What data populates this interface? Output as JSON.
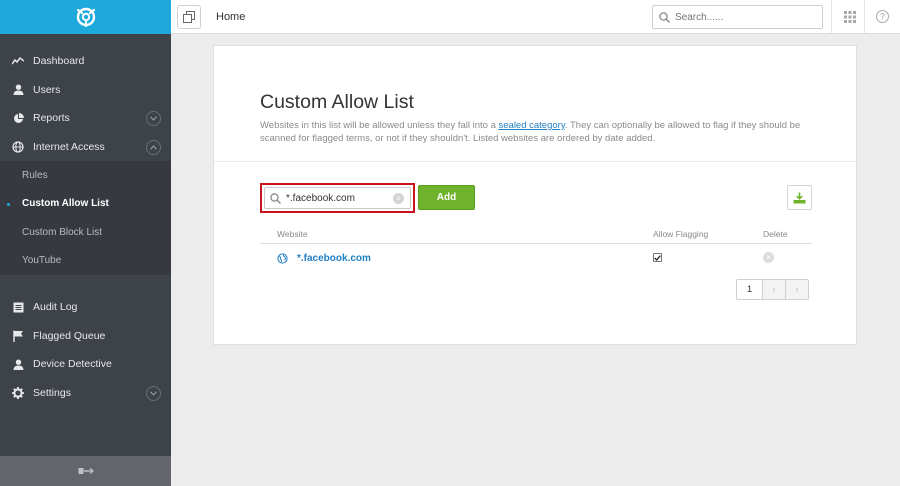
{
  "sidebar": {
    "items": [
      {
        "label": "Dashboard",
        "icon": "activity-icon"
      },
      {
        "label": "Users",
        "icon": "user-icon"
      },
      {
        "label": "Reports",
        "icon": "pie-chart-icon",
        "expanded": false
      },
      {
        "label": "Internet Access",
        "icon": "globe-icon",
        "expanded": true
      }
    ],
    "subitems": [
      {
        "label": "Rules",
        "active": false
      },
      {
        "label": "Custom Allow List",
        "active": true
      },
      {
        "label": "Custom Block List",
        "active": false
      },
      {
        "label": "YouTube",
        "active": false
      }
    ],
    "items2": [
      {
        "label": "Audit Log",
        "icon": "list-icon"
      },
      {
        "label": "Flagged Queue",
        "icon": "flag-icon"
      },
      {
        "label": "Device Detective",
        "icon": "user-icon"
      },
      {
        "label": "Settings",
        "icon": "gear-icon",
        "expanded": false
      }
    ]
  },
  "topbar": {
    "breadcrumb": "Home",
    "search_placeholder": "Search......"
  },
  "page": {
    "title": "Custom Allow List",
    "desc_before": "Websites in this list will be allowed unless they fall into a ",
    "desc_link": "sealed category",
    "desc_after": ". They can optionally be allowed to flag if they should be scanned for flagged terms, or not if they shouldn't. Listed websites are ordered by date added.",
    "input_value": "*.facebook.com",
    "add_label": "Add"
  },
  "table": {
    "headers": [
      "Website",
      "Allow Flagging",
      "Delete"
    ],
    "rows": [
      {
        "website": "*.facebook.com",
        "allow_flagging": true
      }
    ]
  },
  "pagination": {
    "current": "1",
    "prev": "‹",
    "next": "›"
  },
  "colors": {
    "brand": "#1ea9dc",
    "sidebar": "#3e4249",
    "add_button": "#6fb32c",
    "highlight": "#c8141d",
    "link": "#1f7fc4"
  }
}
